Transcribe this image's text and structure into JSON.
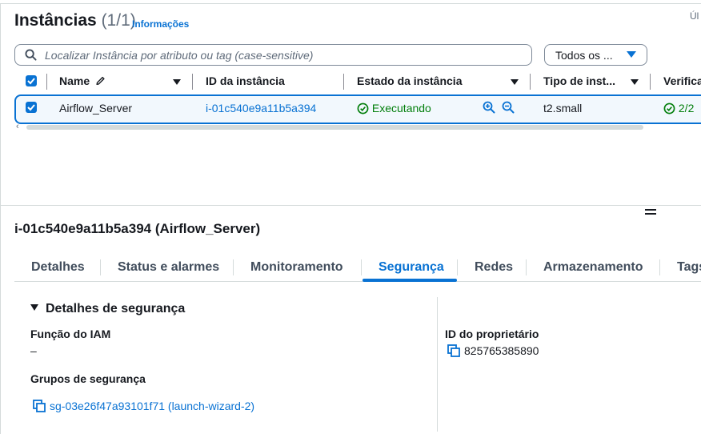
{
  "header": {
    "title": "Instâncias",
    "count": "(1/1)",
    "info_link": "Informações",
    "truncated_right": "Úl"
  },
  "search": {
    "placeholder": "Localizar Instância por atributo ou tag (case-sensitive)",
    "filter_label": "Todos os ..."
  },
  "table": {
    "columns": {
      "name": "Name",
      "id": "ID da instância",
      "state": "Estado da instância",
      "type": "Tipo de inst...",
      "checks": "Verifica"
    },
    "rows": [
      {
        "name": "Airflow_Server",
        "id": "i-01c540e9a11b5a394",
        "state": "Executando",
        "type": "t2.small",
        "checks": "2/2"
      }
    ],
    "scroll_arrow": "‹"
  },
  "detail": {
    "title": "i-01c540e9a11b5a394 (Airflow_Server)",
    "tabs": [
      "Detalhes",
      "Status e alarmes",
      "Monitoramento",
      "Segurança",
      "Redes",
      "Armazenamento",
      "Tags"
    ],
    "active_tab": "Segurança",
    "section_title": "Detalhes de segurança",
    "iam_role_label": "Função do IAM",
    "iam_role_value": "–",
    "security_groups_label": "Grupos de segurança",
    "security_group_value": "sg-03e26f47a93101f71 (launch-wizard-2)",
    "owner_id_label": "ID do proprietário",
    "owner_id_value": "825765385890"
  },
  "colors": {
    "accent": "#0972d3",
    "running": "#037f0c",
    "row_selected_bg": "#f2f8fd"
  }
}
